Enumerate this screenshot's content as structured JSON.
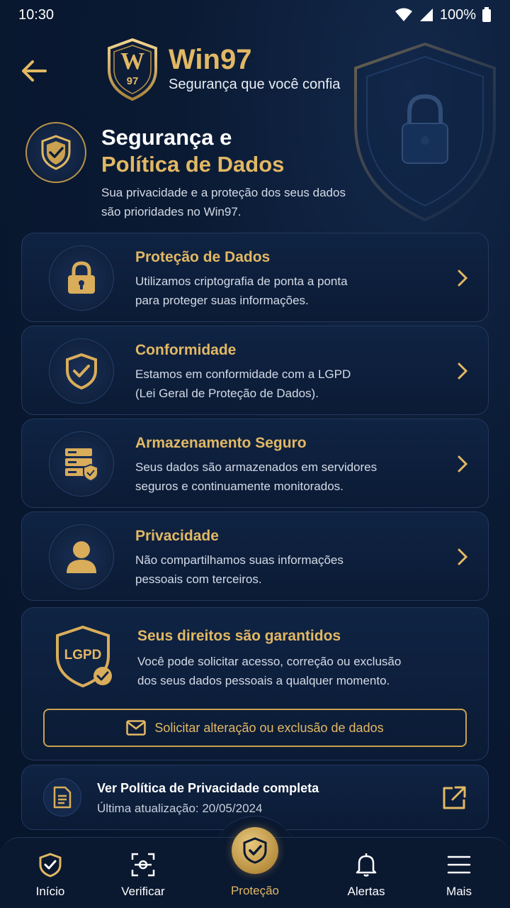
{
  "status_bar": {
    "time": "10:30",
    "battery": "100%"
  },
  "brand": {
    "badge_text_top": "W",
    "badge_text_bottom": "97",
    "name": "Win97",
    "tagline": "Segurança que você confia"
  },
  "hero": {
    "title_line1": "Segurança e",
    "title_line2": "Política de Dados",
    "description_line1": "Sua privacidade e a proteção dos seus dados",
    "description_line2": "são prioridades no Win97."
  },
  "features": [
    {
      "title": "Proteção de Dados",
      "line1": "Utilizamos criptografia de ponta a ponta",
      "line2": "para proteger suas informações.",
      "icon": "lock-icon"
    },
    {
      "title": "Conformidade",
      "line1": "Estamos em conformidade com a LGPD",
      "line2": "(Lei Geral de Proteção de Dados).",
      "icon": "shield-check-icon"
    },
    {
      "title": "Armazenamento Seguro",
      "line1": "Seus dados são armazenados em servidores",
      "line2": "seguros e continuamente monitorados.",
      "icon": "server-shield-icon"
    },
    {
      "title": "Privacidade",
      "line1": "Não compartilhamos suas informações",
      "line2": "pessoais com terceiros.",
      "icon": "user-icon"
    }
  ],
  "rights": {
    "badge_text": "LGPD",
    "title": "Seus direitos são garantidos",
    "line1": "Você pode solicitar acesso, correção ou exclusão",
    "line2": "dos seus dados pessoais a qualquer momento.",
    "button_label": "Solicitar alteração ou exclusão de dados"
  },
  "policy": {
    "title": "Ver Política de Privacidade completa",
    "updated": "Última atualização: 20/05/2024"
  },
  "nav": {
    "items": [
      {
        "label": "Início",
        "icon": "shield-home-icon"
      },
      {
        "label": "Verificar",
        "icon": "scan-icon"
      },
      {
        "label": "Proteção",
        "icon": "shield-check-icon"
      },
      {
        "label": "Alertas",
        "icon": "bell-icon"
      },
      {
        "label": "Mais",
        "icon": "menu-icon"
      }
    ],
    "active_index": 2
  },
  "colors": {
    "accent_gold": "#e2b864",
    "background": "#0a1a33",
    "card": "#0f2343"
  }
}
